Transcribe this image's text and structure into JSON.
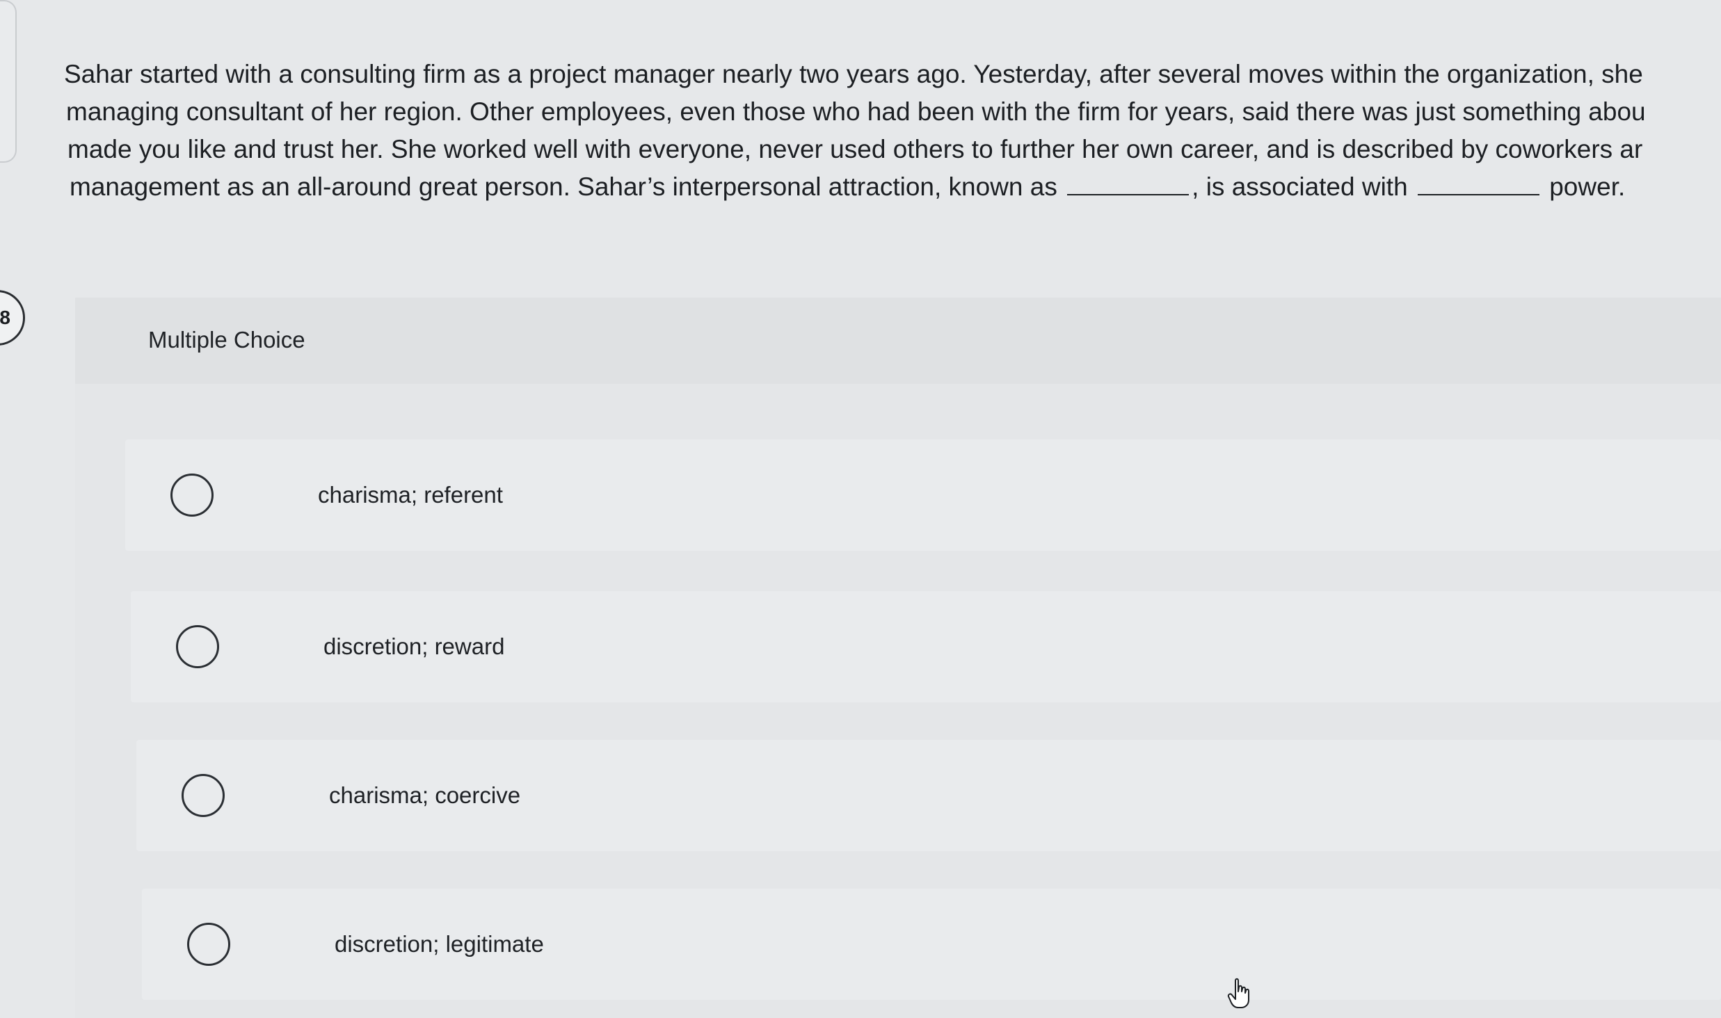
{
  "question": {
    "number": "8",
    "lines": [
      "Sahar started with a consulting firm as a project manager nearly two years ago. Yesterday, after several moves within the organization, she",
      "managing consultant of her region. Other employees, even those who had been with the firm for years, said there was just something abou",
      "made you like and trust her. She worked well with everyone, never used others to further her own career, and is described by coworkers ar"
    ],
    "last_line_part1": "management as an all-around great person. Sahar’s interpersonal attraction, known as",
    "last_line_part2": ", is associated with",
    "last_line_part3": "power."
  },
  "multiple_choice": {
    "title": "Multiple Choice",
    "options": [
      {
        "label": "charisma; referent"
      },
      {
        "label": "discretion; reward"
      },
      {
        "label": "charisma; coercive"
      },
      {
        "label": "discretion; legitimate"
      }
    ]
  },
  "icons": {
    "cursor": "hand-pointer-icon",
    "radio": "radio-unselected-icon"
  }
}
